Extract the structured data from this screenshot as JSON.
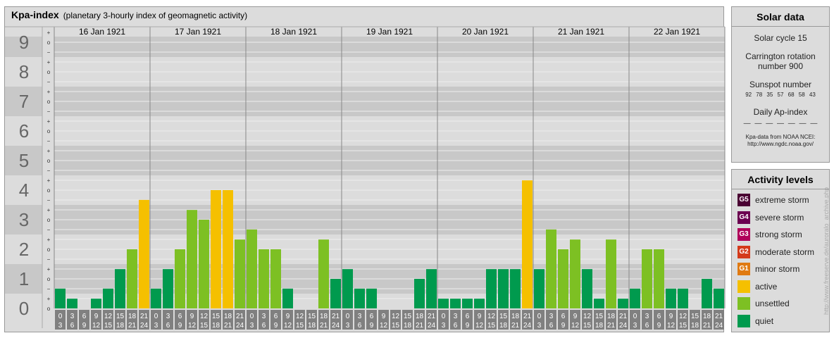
{
  "title": {
    "main": "Kpa-index",
    "sub": "(planetary 3-hourly index of geomagnetic activity)"
  },
  "solar": {
    "heading": "Solar data",
    "cycle": "Solar cycle 15",
    "carrington_line1": "Carrington rotation",
    "carrington_line2": "number 900",
    "sunspot_heading": "Sunspot number",
    "sunspot_values": "92 78 35 57 68 58 43",
    "ap_heading": "Daily Ap-index",
    "ap_values": "— — — — — — —",
    "note_line1": "Kpa-data from NOAA NCEI:",
    "note_line2": "http://www.ngdc.noaa.gov/"
  },
  "activity": {
    "heading": "Activity levels",
    "levels": [
      {
        "code": "G5",
        "label": "extreme storm",
        "color": "#4a0033"
      },
      {
        "code": "G4",
        "label": "severe storm",
        "color": "#6b0050"
      },
      {
        "code": "G3",
        "label": "strong storm",
        "color": "#b0005a"
      },
      {
        "code": "G2",
        "label": "moderate storm",
        "color": "#d43a1a"
      },
      {
        "code": "G1",
        "label": "minor storm",
        "color": "#e07a12"
      },
      {
        "code": "",
        "label": "active",
        "color": "#f5c000"
      },
      {
        "code": "",
        "label": "unsettled",
        "color": "#7dc023"
      },
      {
        "code": "",
        "label": "quiet",
        "color": "#009a4e"
      }
    ]
  },
  "watermark": "http://www.freeserve.de/auroralo_archive.php",
  "chart_data": {
    "type": "bar",
    "y_labels": [
      "0",
      "1",
      "2",
      "3",
      "4",
      "5",
      "6",
      "7",
      "8",
      "9"
    ],
    "minor_labels": [
      "o",
      "+",
      "−"
    ],
    "ylim": [
      0,
      9.33
    ],
    "days": [
      "16 Jan 1921",
      "17 Jan 1921",
      "18 Jan 1921",
      "19 Jan 1921",
      "20 Jan 1921",
      "21 Jan 1921",
      "22 Jan 1921"
    ],
    "hours_top": [
      "0",
      "3",
      "6",
      "9",
      "12",
      "15",
      "18",
      "21"
    ],
    "hours_bottom": [
      "3",
      "6",
      "9",
      "12",
      "15",
      "18",
      "21",
      "24"
    ],
    "values": [
      [
        0.67,
        0.33,
        0.0,
        0.33,
        0.67,
        1.33,
        2.0,
        3.67
      ],
      [
        0.67,
        1.33,
        2.0,
        3.33,
        3.0,
        4.0,
        4.0,
        2.33
      ],
      [
        2.67,
        2.0,
        2.0,
        0.67,
        0.0,
        0.0,
        2.33,
        1.0
      ],
      [
        1.33,
        0.67,
        0.67,
        0.0,
        0.0,
        0.0,
        1.0,
        1.33
      ],
      [
        0.33,
        0.33,
        0.33,
        0.33,
        1.33,
        1.33,
        1.33,
        4.33
      ],
      [
        1.33,
        2.67,
        2.0,
        2.33,
        1.33,
        0.33,
        2.33,
        0.33
      ],
      [
        0.67,
        2.0,
        2.0,
        0.67,
        0.67,
        0.0,
        1.0,
        0.67
      ]
    ],
    "colors": {
      "quiet": "#009a4e",
      "unsettled": "#7dc023",
      "active": "#f5c000",
      "band_dark": "#c8c8c8",
      "band_light": "#dcdcdc",
      "hour_box": "#808080"
    }
  }
}
